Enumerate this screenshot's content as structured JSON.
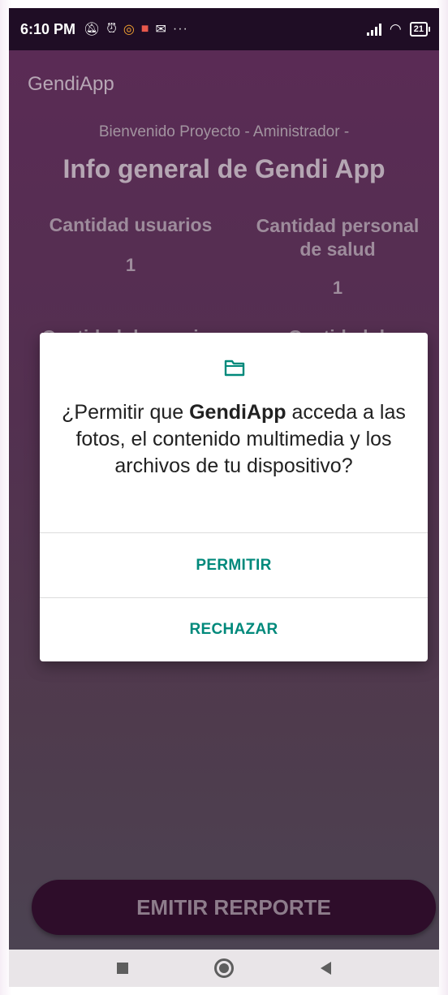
{
  "status_bar": {
    "time": "6:10 PM",
    "icons": [
      "notifications-off-icon",
      "alarm-icon",
      "instagram-icon",
      "photos-icon",
      "gmail-icon",
      "more-icon"
    ],
    "more": "···",
    "battery": "21"
  },
  "app": {
    "title": "GendiApp",
    "welcome": "Bienvenido Proyecto - Aministrador -",
    "heading": "Info general de Gendi App",
    "stats": {
      "users_label": "Cantidad usuarios",
      "users_value": "1",
      "health_label": "Cantidad personal de salud",
      "health_value": "1",
      "complaints_label": "Cantidad denuncias",
      "other_label": "Cantidad de"
    },
    "emit_button": "EMITIR RERPORTE"
  },
  "dialog": {
    "icon": "folder-icon",
    "message_before": "¿Permitir que ",
    "message_app": "GendiApp",
    "message_after": " acceda a las fotos, el contenido multimedia y los archivos de tu dispositivo?",
    "allow": "PERMITIR",
    "deny": "RECHAZAR",
    "accent_color": "#00897b"
  },
  "nav_bar": {
    "items": [
      "recents-icon",
      "home-icon",
      "back-icon"
    ]
  }
}
